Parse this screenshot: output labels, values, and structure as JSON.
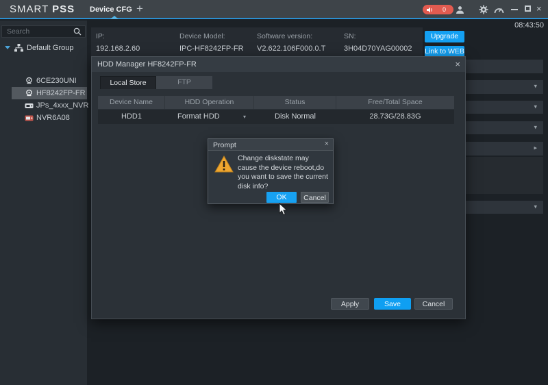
{
  "colors": {
    "accent_blue": "#14a0f2",
    "topbar_underline": "#2b8fd0",
    "alert_red": "#e25b50",
    "warning_orange": "#efa62f",
    "selected_row_gray": "#53595f"
  },
  "glyphs": {
    "plus": "+",
    "close": "×",
    "caret_down": "▾",
    "caret_right": "▸",
    "exclamation": "!"
  },
  "topbar": {
    "brand_smart": "SMART",
    "brand_pss": "PSS",
    "tab_device_cfg": "Device CFG",
    "notification_count": "0",
    "time": "08:43:50"
  },
  "sidebar": {
    "search_placeholder": "Search",
    "group_label": "Default Group",
    "devices": [
      {
        "label": "6CE230UNI"
      },
      {
        "label": "HF8242FP-FR"
      },
      {
        "label": "JPs_4xxx_NVR"
      },
      {
        "label": "NVR6A08"
      }
    ]
  },
  "device_info": {
    "fields": [
      {
        "label": "IP:",
        "value": "192.168.2.60"
      },
      {
        "label": "Device Model:",
        "value": "IPC-HF8242FP-FR"
      },
      {
        "label": "Software version:",
        "value": "V2.622.106F000.0.T"
      },
      {
        "label": "SN:",
        "value": "3H04D70YAG00002"
      }
    ],
    "upgrade_label": "Upgrade",
    "link_web_label": "Link to WEB"
  },
  "hdd_dialog": {
    "title": "HDD Manager HF8242FP-FR",
    "tabs": [
      {
        "label": "Local Store"
      },
      {
        "label": "FTP"
      }
    ],
    "table": {
      "columns": [
        "Device Name",
        "HDD Operation",
        "Status",
        "Free/Total Space"
      ],
      "rows": [
        {
          "device_name": "HDD1",
          "hdd_operation": "Format HDD",
          "status": "Disk Normal",
          "free_total": "28.73G/28.83G"
        }
      ]
    },
    "footer": {
      "apply_label": "Apply",
      "save_label": "Save",
      "cancel_label": "Cancel"
    }
  },
  "prompt": {
    "title": "Prompt",
    "message": "Change diskstate may cause the device reboot,do you want to save the current disk info?",
    "ok_label": "OK",
    "cancel_label": "Cancel"
  }
}
